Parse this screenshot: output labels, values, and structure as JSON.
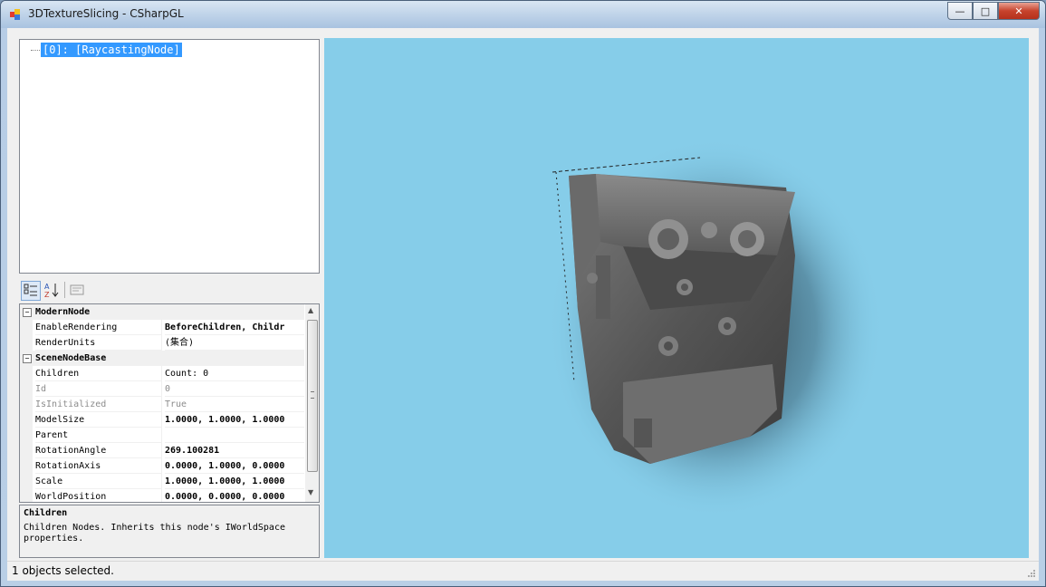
{
  "window": {
    "title": "3DTextureSlicing - CSharpGL",
    "buttons": {
      "minimize": "—",
      "maximize": "□",
      "close": "✕"
    }
  },
  "tree": {
    "nodes": [
      {
        "label": "[0]: [RaycastingNode]",
        "selected": true
      }
    ]
  },
  "toolbar": {
    "icons": [
      "categorized-icon",
      "alphabetical-sort-icon",
      "property-pages-icon"
    ]
  },
  "property_grid": {
    "categories": [
      {
        "name": "ModernNode",
        "properties": [
          {
            "name": "EnableRendering",
            "value": "BeforeChildren, Childr",
            "bold": true,
            "readonly": false
          },
          {
            "name": "RenderUnits",
            "value": "(集合)",
            "bold": false,
            "readonly": false
          }
        ]
      },
      {
        "name": "SceneNodeBase",
        "properties": [
          {
            "name": "Children",
            "value": "Count: 0",
            "bold": false,
            "readonly": false
          },
          {
            "name": "Id",
            "value": "0",
            "bold": false,
            "readonly": true
          },
          {
            "name": "IsInitialized",
            "value": "True",
            "bold": false,
            "readonly": true
          },
          {
            "name": "ModelSize",
            "value": "1.0000, 1.0000, 1.0000",
            "bold": true,
            "readonly": false
          },
          {
            "name": "Parent",
            "value": "",
            "bold": false,
            "readonly": false
          },
          {
            "name": "RotationAngle",
            "value": "269.100281",
            "bold": true,
            "readonly": false
          },
          {
            "name": "RotationAxis",
            "value": "0.0000, 1.0000, 0.0000",
            "bold": true,
            "readonly": false
          },
          {
            "name": "Scale",
            "value": "1.0000, 1.0000, 1.0000",
            "bold": true,
            "readonly": false
          },
          {
            "name": "WorldPosition",
            "value": "0.0000, 0.0000, 0.0000",
            "bold": true,
            "readonly": false
          }
        ]
      }
    ]
  },
  "help": {
    "title": "Children",
    "description": "Children Nodes. Inherits this node's IWorldSpace properties."
  },
  "viewport": {
    "background": "#86cde9",
    "content": "volume-rendered engine block"
  },
  "status": {
    "text": "1 objects selected."
  }
}
